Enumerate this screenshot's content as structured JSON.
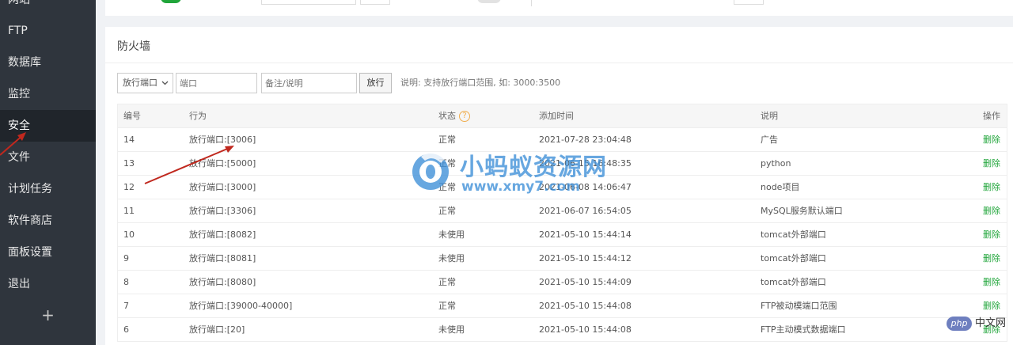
{
  "sidebar": {
    "items": [
      {
        "label": "网站",
        "active": false
      },
      {
        "label": "FTP",
        "active": false
      },
      {
        "label": "数据库",
        "active": false
      },
      {
        "label": "监控",
        "active": false
      },
      {
        "label": "安全",
        "active": true
      },
      {
        "label": "文件",
        "active": false
      },
      {
        "label": "计划任务",
        "active": false
      },
      {
        "label": "软件商店",
        "active": false
      },
      {
        "label": "面板设置",
        "active": false
      },
      {
        "label": "退出",
        "active": false
      }
    ],
    "add_label": "+"
  },
  "firewall": {
    "title": "防火墙",
    "select_value": "放行端口",
    "port_placeholder": "端口",
    "note_placeholder": "备注/说明",
    "allow_button": "放行",
    "hint": "说明: 支持放行端口范围, 如: 3000:3500",
    "columns": {
      "id": "编号",
      "action": "行为",
      "status": "状态",
      "status_help": "?",
      "added": "添加时间",
      "note": "说明",
      "op": "操作"
    },
    "rows": [
      {
        "id": "14",
        "action": "放行端口:[3006]",
        "status": "正常",
        "added": "2021-07-28 23:04:48",
        "note": "广告",
        "op": "删除"
      },
      {
        "id": "13",
        "action": "放行端口:[5000]",
        "status": "正常",
        "added": "2021-06-15 16:48:35",
        "note": "python",
        "op": "删除"
      },
      {
        "id": "12",
        "action": "放行端口:[3000]",
        "status": "正常",
        "added": "2021-06-08 14:06:47",
        "note": "node项目",
        "op": "删除"
      },
      {
        "id": "11",
        "action": "放行端口:[3306]",
        "status": "正常",
        "added": "2021-06-07 16:54:05",
        "note": "MySQL服务默认端口",
        "op": "删除"
      },
      {
        "id": "10",
        "action": "放行端口:[8082]",
        "status": "未使用",
        "added": "2021-05-10 15:44:14",
        "note": "tomcat外部端口",
        "op": "删除"
      },
      {
        "id": "9",
        "action": "放行端口:[8081]",
        "status": "未使用",
        "added": "2021-05-10 15:44:12",
        "note": "tomcat外部端口",
        "op": "删除"
      },
      {
        "id": "8",
        "action": "放行端口:[8080]",
        "status": "正常",
        "added": "2021-05-10 15:44:09",
        "note": "tomcat外部端口",
        "op": "删除"
      },
      {
        "id": "7",
        "action": "放行端口:[39000-40000]",
        "status": "正常",
        "added": "2021-05-10 15:44:08",
        "note": "FTP被动模端口范围",
        "op": "删除"
      },
      {
        "id": "6",
        "action": "放行端口:[20]",
        "status": "未使用",
        "added": "2021-05-10 15:44:08",
        "note": "FTP主动模式数据端口",
        "op": "删除"
      }
    ]
  },
  "watermark": {
    "name": "小蚂蚁资源网",
    "url": "www.xmy7.com",
    "color": "#3d8fd8"
  },
  "badge": {
    "php": "php",
    "cn": "中文网"
  },
  "colors": {
    "sidebar_bg": "#2f353d",
    "sidebar_active": "#20252b",
    "accent_green": "#20a53a",
    "annotation_red": "#c0281e"
  }
}
